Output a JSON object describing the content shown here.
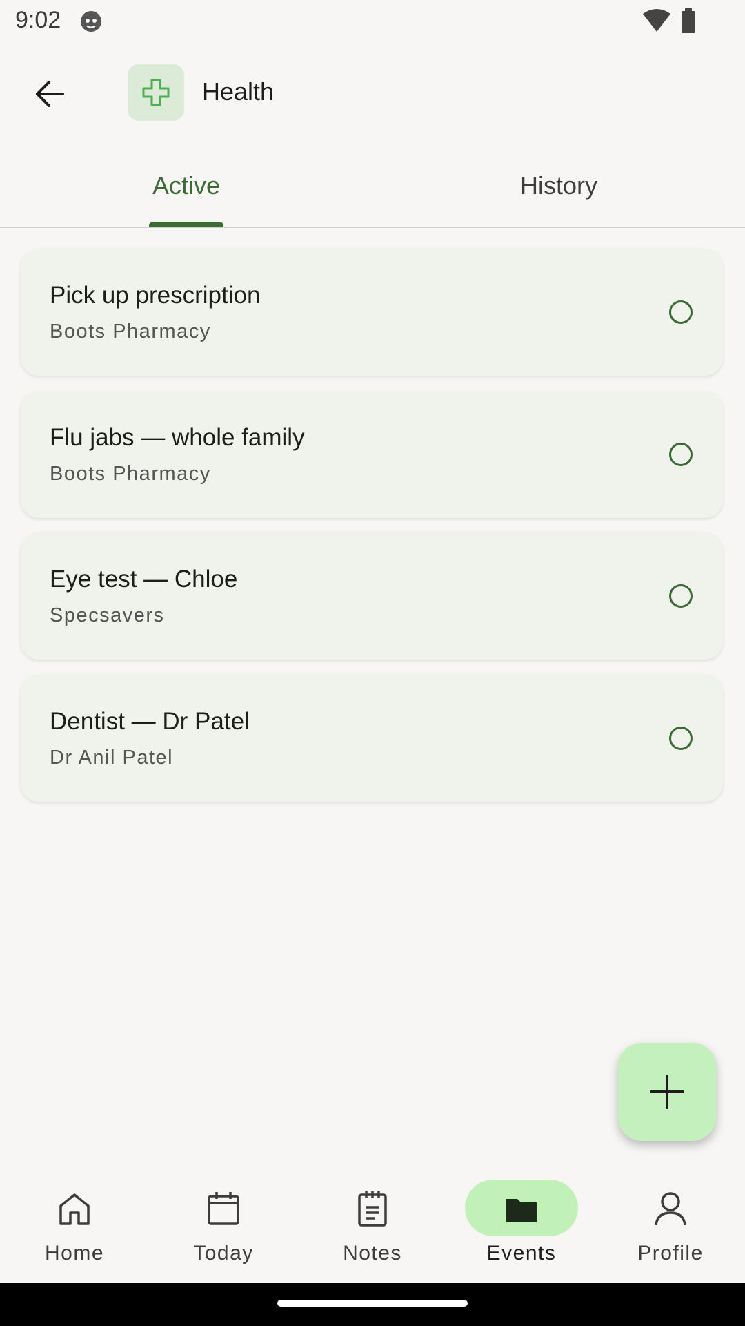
{
  "status_bar": {
    "time": "9:02"
  },
  "header": {
    "title": "Health",
    "category_icon": "medical-cross-icon",
    "accent": "#3b6a35"
  },
  "tabs": [
    {
      "label": "Active",
      "selected": true
    },
    {
      "label": "History",
      "selected": false
    }
  ],
  "events": [
    {
      "title": "Pick up prescription",
      "subtitle": "Boots Pharmacy",
      "done": false
    },
    {
      "title": "Flu jabs — whole family",
      "subtitle": "Boots Pharmacy",
      "done": false
    },
    {
      "title": "Eye test — Chloe",
      "subtitle": "Specsavers",
      "done": false
    },
    {
      "title": "Dentist — Dr Patel",
      "subtitle": "Dr Anil Patel",
      "done": false
    }
  ],
  "fab": {
    "icon": "plus-icon"
  },
  "bottom_nav": [
    {
      "label": "Home",
      "icon": "home-icon",
      "active": false
    },
    {
      "label": "Today",
      "icon": "calendar-icon",
      "active": false
    },
    {
      "label": "Notes",
      "icon": "notepad-icon",
      "active": false
    },
    {
      "label": "Events",
      "icon": "folder-icon",
      "active": true
    },
    {
      "label": "Profile",
      "icon": "person-icon",
      "active": false
    }
  ],
  "colors": {
    "background": "#f7f6f4",
    "card": "#f0f3ec",
    "active_pill": "#c1f0b8",
    "fab": "#c3f0bc"
  }
}
